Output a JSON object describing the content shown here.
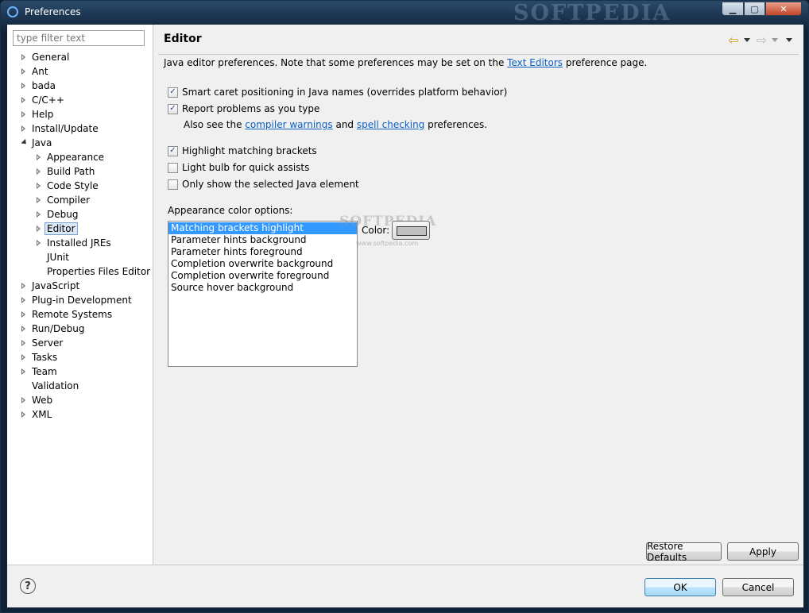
{
  "window": {
    "title": "Preferences",
    "watermark": "SOFTPEDIA",
    "min_glyph": "▁",
    "max_glyph": "▢",
    "close_glyph": "✕"
  },
  "sidebar": {
    "filter_placeholder": "type filter text",
    "items": [
      {
        "label": "General",
        "expander": "closed",
        "level": 0
      },
      {
        "label": "Ant",
        "expander": "closed",
        "level": 0
      },
      {
        "label": "bada",
        "expander": "closed",
        "level": 0
      },
      {
        "label": "C/C++",
        "expander": "closed",
        "level": 0
      },
      {
        "label": "Help",
        "expander": "closed",
        "level": 0
      },
      {
        "label": "Install/Update",
        "expander": "closed",
        "level": 0
      },
      {
        "label": "Java",
        "expander": "open",
        "level": 0
      },
      {
        "label": "Appearance",
        "expander": "closed",
        "level": 1
      },
      {
        "label": "Build Path",
        "expander": "closed",
        "level": 1
      },
      {
        "label": "Code Style",
        "expander": "closed",
        "level": 1
      },
      {
        "label": "Compiler",
        "expander": "closed",
        "level": 1
      },
      {
        "label": "Debug",
        "expander": "closed",
        "level": 1
      },
      {
        "label": "Editor",
        "expander": "closed",
        "level": 1,
        "selected": true
      },
      {
        "label": "Installed JREs",
        "expander": "closed",
        "level": 1
      },
      {
        "label": "JUnit",
        "expander": "none",
        "level": 1
      },
      {
        "label": "Properties Files Editor",
        "expander": "none",
        "level": 1
      },
      {
        "label": "JavaScript",
        "expander": "closed",
        "level": 0
      },
      {
        "label": "Plug-in Development",
        "expander": "closed",
        "level": 0
      },
      {
        "label": "Remote Systems",
        "expander": "closed",
        "level": 0
      },
      {
        "label": "Run/Debug",
        "expander": "closed",
        "level": 0
      },
      {
        "label": "Server",
        "expander": "closed",
        "level": 0
      },
      {
        "label": "Tasks",
        "expander": "closed",
        "level": 0
      },
      {
        "label": "Team",
        "expander": "closed",
        "level": 0
      },
      {
        "label": "Validation",
        "expander": "none",
        "level": 0
      },
      {
        "label": "Web",
        "expander": "closed",
        "level": 0
      },
      {
        "label": "XML",
        "expander": "closed",
        "level": 0
      }
    ]
  },
  "page": {
    "title": "Editor",
    "nav_back_icon": "⇦",
    "nav_forward_icon": "⇨",
    "description_prefix": "Java editor preferences. Note that some preferences may be set on the ",
    "description_link": "Text Editors",
    "description_suffix": " preference page.",
    "checkboxes": [
      {
        "label": "Smart caret positioning in Java names (overrides platform behavior)",
        "checked": true
      },
      {
        "label": "Report problems as you type",
        "checked": true
      },
      {
        "label": "Highlight matching brackets",
        "checked": true
      },
      {
        "label": "Light bulb for quick assists",
        "checked": false
      },
      {
        "label": "Only show the selected Java element",
        "checked": false
      }
    ],
    "hint": {
      "prefix": "Also see the ",
      "link1": "compiler warnings",
      "middle": " and ",
      "link2": "spell checking",
      "suffix": " preferences."
    },
    "appearance_label": "Appearance color options:",
    "color_options": [
      "Matching brackets highlight",
      "Parameter hints background",
      "Parameter hints foreground",
      "Completion overwrite background",
      "Completion overwrite foreground",
      "Source hover background"
    ],
    "selected_color_option": 0,
    "color_label": "Color:",
    "swatch_color": "#c0c0c0",
    "watermark_text": "SOFTPEDIA",
    "watermark_url": "www.softpedia.com"
  },
  "buttons": {
    "restore_defaults": "Restore Defaults",
    "apply": "Apply",
    "ok": "OK",
    "cancel": "Cancel",
    "help": "?"
  }
}
